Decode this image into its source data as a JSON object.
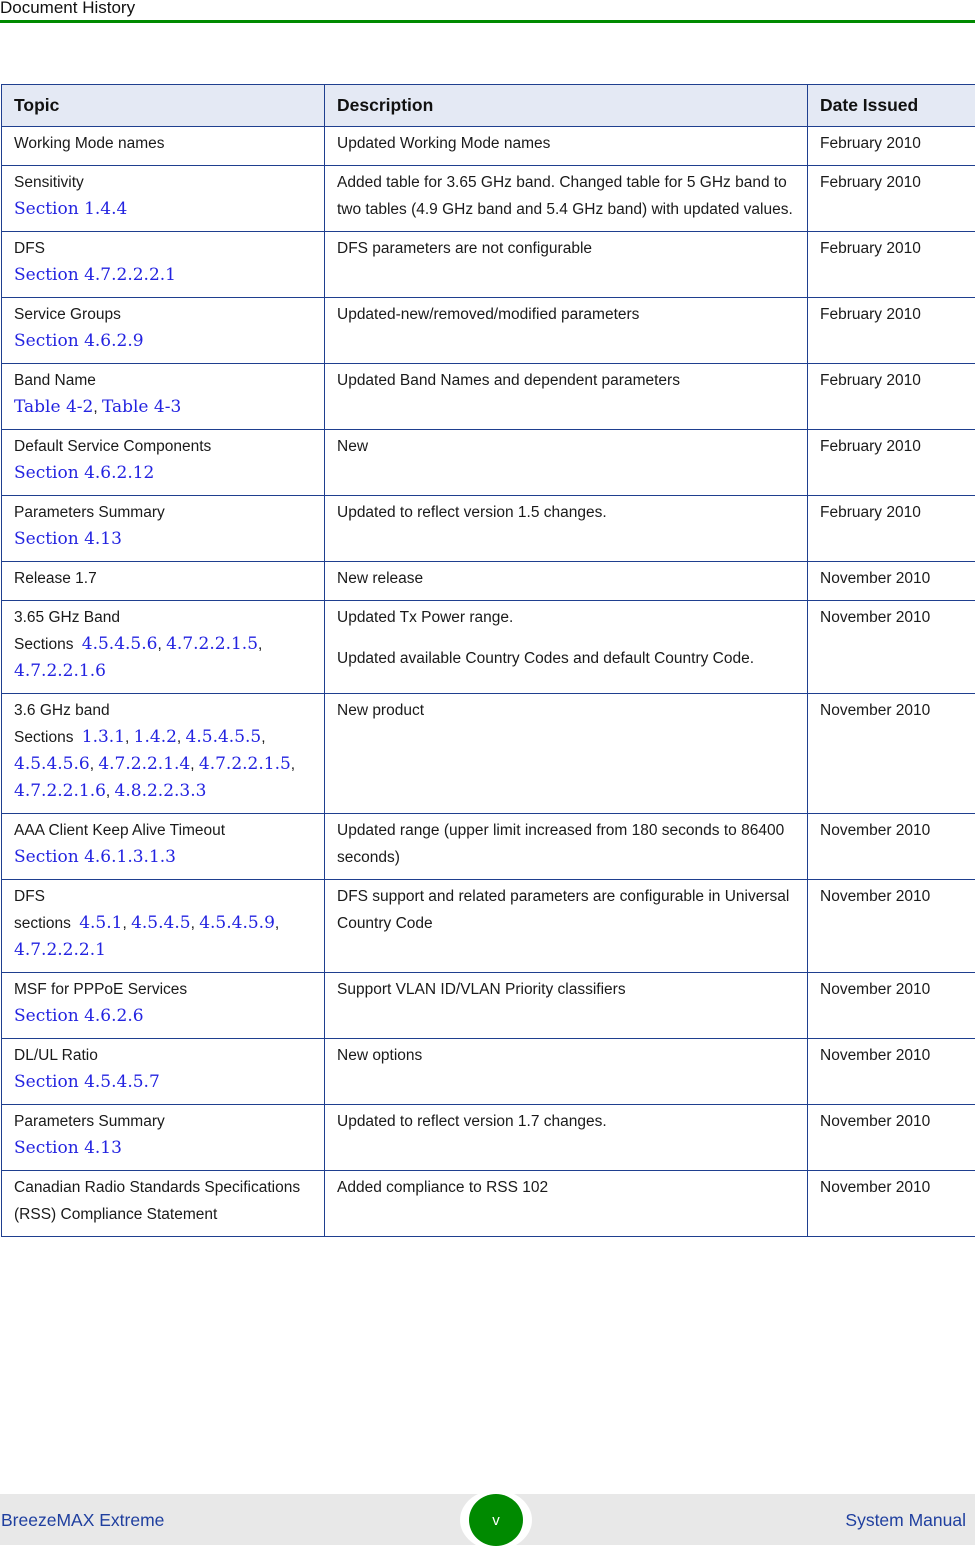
{
  "header": {
    "title": "Document History",
    "accent_color": "#008a00"
  },
  "table": {
    "columns": [
      "Topic",
      "Description",
      "Date Issued"
    ],
    "rows": [
      {
        "topic": "Working Mode names",
        "refs_label": "",
        "refs": [],
        "description": [
          "Updated Working Mode names"
        ],
        "date": "February 2010"
      },
      {
        "topic": "Sensitivity",
        "refs_label": "",
        "refs": [
          "Section 1.4.4"
        ],
        "description": [
          "Added table for 3.65 GHz band. Changed table for 5 GHz band to two tables (4.9 GHz band and 5.4 GHz band) with updated values."
        ],
        "date": "February 2010"
      },
      {
        "topic": "DFS",
        "refs_label": "",
        "refs": [
          "Section 4.7.2.2.2.1"
        ],
        "description": [
          "DFS parameters are not configurable"
        ],
        "date": "February 2010"
      },
      {
        "topic": "Service Groups",
        "refs_label": "",
        "refs": [
          "Section 4.6.2.9"
        ],
        "description": [
          "Updated-new/removed/modified parameters"
        ],
        "date": "February 2010"
      },
      {
        "topic": "Band Name",
        "refs_label": "",
        "refs": [
          "Table 4-2",
          "Table 4-3"
        ],
        "description": [
          "Updated Band Names and dependent parameters"
        ],
        "date": "February 2010"
      },
      {
        "topic": "Default Service Components",
        "refs_label": "",
        "refs": [
          "Section 4.6.2.12"
        ],
        "description": [
          "New"
        ],
        "date": "February 2010"
      },
      {
        "topic": "Parameters Summary",
        "refs_label": "",
        "refs": [
          "Section 4.13"
        ],
        "description": [
          "Updated to reflect version 1.5 changes."
        ],
        "date": "February 2010"
      },
      {
        "topic": "Release 1.7",
        "refs_label": "",
        "refs": [],
        "description": [
          "New release"
        ],
        "date": "November 2010"
      },
      {
        "topic": "3.65 GHz Band",
        "refs_label": "Sections",
        "refs": [
          "4.5.4.5.6",
          "4.7.2.2.1.5",
          "4.7.2.2.1.6"
        ],
        "description": [
          "Updated Tx Power range.",
          "Updated available Country Codes and default Country Code."
        ],
        "date": "November 2010"
      },
      {
        "topic": "3.6 GHz band",
        "refs_label": "Sections",
        "refs": [
          "1.3.1",
          "1.4.2",
          "4.5.4.5.5",
          "4.5.4.5.6",
          "4.7.2.2.1.4",
          "4.7.2.2.1.5",
          "4.7.2.2.1.6",
          "4.8.2.2.3.3"
        ],
        "description": [
          "New product"
        ],
        "date": "November 2010"
      },
      {
        "topic": "AAA Client Keep Alive Timeout",
        "refs_label": "",
        "refs": [
          "Section 4.6.1.3.1.3"
        ],
        "description": [
          "Updated range (upper limit increased from 180 seconds to 86400 seconds)"
        ],
        "date": "November 2010"
      },
      {
        "topic": "DFS",
        "refs_label": "sections",
        "refs": [
          "4.5.1",
          "4.5.4.5",
          "4.5.4.5.9",
          "4.7.2.2.2.1"
        ],
        "description": [
          "DFS support and related parameters are configurable in Universal Country Code"
        ],
        "date": "November 2010"
      },
      {
        "topic": "MSF for PPPoE Services",
        "refs_label": "",
        "refs": [
          "Section 4.6.2.6"
        ],
        "description": [
          "Support VLAN ID/VLAN Priority classifiers"
        ],
        "date": "November 2010"
      },
      {
        "topic": "DL/UL Ratio",
        "refs_label": "",
        "refs": [
          "Section 4.5.4.5.7"
        ],
        "description": [
          "New options"
        ],
        "date": "November 2010"
      },
      {
        "topic": "Parameters Summary",
        "refs_label": "",
        "refs": [
          "Section 4.13"
        ],
        "description": [
          "Updated to reflect version 1.7 changes."
        ],
        "date": "November 2010"
      },
      {
        "topic": "Canadian Radio Standards Specifications (RSS) Compliance Statement",
        "refs_label": "",
        "refs": [],
        "description": [
          "Added compliance to RSS 102"
        ],
        "date": "November 2010"
      }
    ]
  },
  "footer": {
    "product": "BreezeMAX Extreme",
    "page_number": "v",
    "manual": "System Manual",
    "badge_color": "#008a00"
  }
}
